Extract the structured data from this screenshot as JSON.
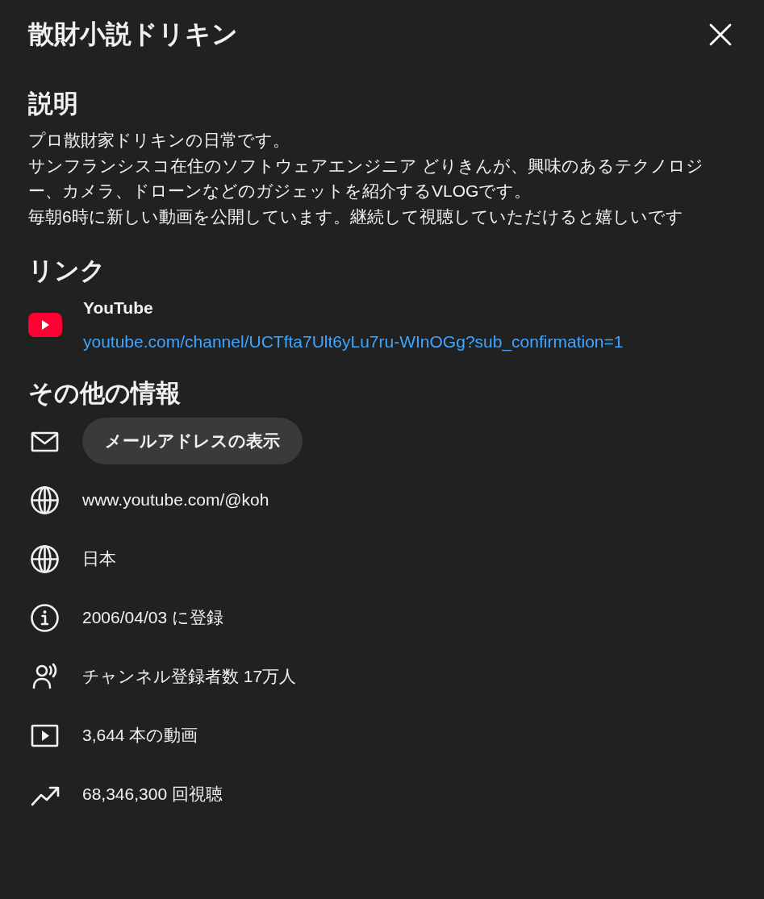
{
  "dialog": {
    "title": "散財小説ドリキン"
  },
  "description": {
    "heading": "説明",
    "paragraphs": [
      "プロ散財家ドリキンの日常です。",
      "サンフランシスコ在住のソフトウェアエンジニア どりきんが、興味のあるテクノロジー、カメラ、ドローンなどのガジェットを紹介するVLOGです。",
      "毎朝6時に新しい動画を公開しています。継続して視聴していただけると嬉しいです"
    ]
  },
  "links": {
    "heading": "リンク",
    "items": [
      {
        "title": "YouTube",
        "url": "youtube.com/channel/UCTfta7Ult6yLu7ru-WInOGg?sub_confirmation=1"
      }
    ]
  },
  "other_info": {
    "heading": "その他の情報",
    "rows": [
      {
        "kind": "email",
        "text": "メールアドレスの表示"
      },
      {
        "kind": "website",
        "text": "www.youtube.com/@koh"
      },
      {
        "kind": "country",
        "text": "日本"
      },
      {
        "kind": "joined",
        "text": "2006/04/03 に登録"
      },
      {
        "kind": "subscribers",
        "text": "チャンネル登録者数 17万人"
      },
      {
        "kind": "videos",
        "text": "3,644 本の動画"
      },
      {
        "kind": "views",
        "text": "68,346,300 回視聴"
      }
    ]
  }
}
